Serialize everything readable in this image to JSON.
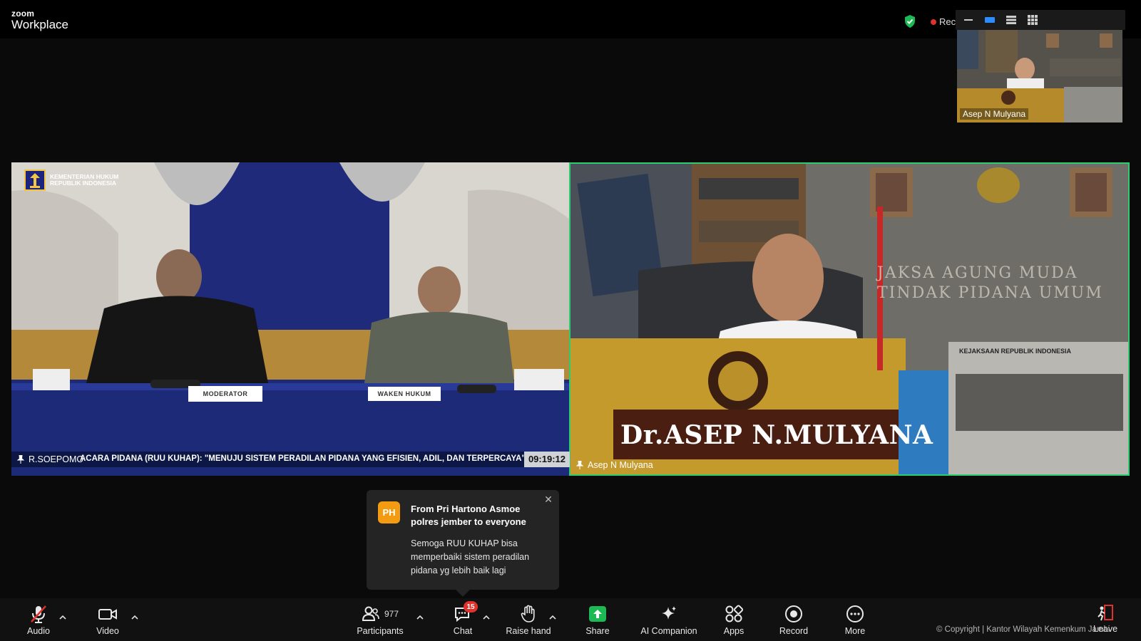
{
  "app": {
    "brand": "zoom",
    "product": "Workplace"
  },
  "top": {
    "recording_label": "Recording"
  },
  "thumbnail": {
    "name": "Asep N Mulyana"
  },
  "tiles": {
    "left": {
      "name": "R.SOEPOMO",
      "ministry_line1": "KEMENTERIAN HUKUM",
      "ministry_line2": "REPUBLIK INDONESIA",
      "plate_moderator": "MODERATOR",
      "plate_second": "WAKEN HUKUM",
      "ticker": "ACARA PIDANA (RUU KUHAP): \"MENUJU SISTEM PERADILAN PIDANA YANG EFISIEN, ADIL, DAN TERPERCAYA\"",
      "time": "09:19:12"
    },
    "right": {
      "name": "Asep N Mulyana",
      "plaque": "Dr.ASEP N.MULYANA",
      "wall_line1": "JAKSA AGUNG MUDA",
      "wall_line2": "TINDAK PIDANA UMUM",
      "banner": "KEJAKSAAN REPUBLIK INDONESIA"
    }
  },
  "notification": {
    "initials": "PH",
    "from": "From Pri Hartono Asmoe polres jember to everyone",
    "message": "Semoga RUU KUHAP bisa memperbaiki sistem peradilan pidana yg lebih baik lagi"
  },
  "toolbar": {
    "audio": "Audio",
    "video": "Video",
    "participants": "Participants",
    "participants_count": "977",
    "chat": "Chat",
    "chat_badge": "15",
    "raise_hand": "Raise hand",
    "share": "Share",
    "ai_companion": "AI Companion",
    "apps": "Apps",
    "record": "Record",
    "more": "More",
    "leave": "Leave",
    "copyright": "© Copyright | Kantor Wilayah Kemenkum Jambi"
  },
  "colors": {
    "active_speaker": "#2ecc71",
    "share_green": "#1db954",
    "badge_red": "#e0322d",
    "avatar_orange": "#f39c12"
  }
}
